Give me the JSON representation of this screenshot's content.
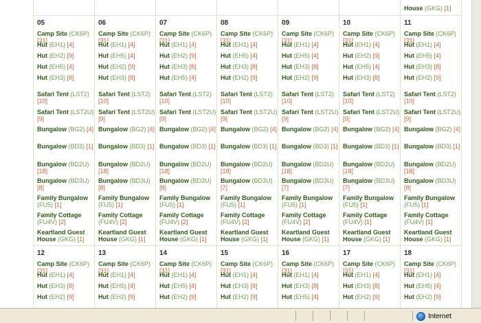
{
  "window": {
    "zone_label": "Internet",
    "zone_icon": "globe-icon"
  },
  "colors": {
    "name": "#2d5a16",
    "code": "#6a9a4a",
    "count": "#c86432",
    "grid": "#d8e6c8"
  },
  "calendar": {
    "top_partial": [
      {
        "cols": 6,
        "entries": []
      },
      {
        "cols": 1,
        "entries": [
          {
            "name": "House",
            "code": "(GKG)",
            "count": "[1]"
          }
        ]
      }
    ],
    "weeks": [
      {
        "days": [
          {
            "num": "05",
            "entries": [
              [
                "Camp Site",
                "(CK6P)",
                "[31]"
              ],
              [
                "Hut",
                "(EH1)",
                "[4]"
              ],
              [
                "Hut",
                "(EH2)",
                "[9]"
              ],
              [
                "Hut",
                "(EH5)",
                "[4]"
              ],
              [
                "Hut",
                "(EH3)",
                "[8]"
              ],
              [
                "Safari Tent",
                "(LST2)",
                "[10]"
              ],
              [
                "Safari Tent",
                "(LST2U)",
                "[9]"
              ],
              [
                "Bungalow",
                "(BG2)",
                "[4]"
              ],
              [
                "Bungalow",
                "(BD3)",
                "[1]"
              ],
              [
                "Bungalow",
                "(BD2U)",
                "[18]"
              ],
              [
                "Bungalow",
                "(BD3U)",
                "[8]"
              ],
              [
                "Family Bungalow",
                "(FU5)",
                "[1]"
              ],
              [
                "Family Cottage",
                "(FU4V)",
                "[2]"
              ],
              [
                "Keartland Guest House",
                "(GKG)",
                "[1]"
              ]
            ]
          },
          {
            "num": "06",
            "entries": [
              [
                "Camp Site",
                "(CK6P)",
                "[31]"
              ],
              [
                "Hut",
                "(EH1)",
                "[4]"
              ],
              [
                "Hut",
                "(EH5)",
                "[4]"
              ],
              [
                "Hut",
                "(EH2)",
                "[9]"
              ],
              [
                "Hut",
                "(EH3)",
                "[8]"
              ],
              [
                "Safari Tent",
                "(LST2)",
                "[10]"
              ],
              [
                "Safari Tent",
                "(LST2U)",
                "[9]"
              ],
              [
                "Bungalow",
                "(BG2)",
                "[4]"
              ],
              [
                "Bungalow",
                "(BD3)",
                "[1]"
              ],
              [
                "Bungalow",
                "(BD2U)",
                "[18]"
              ],
              [
                "Bungalow",
                "(BD3U)",
                "[8]"
              ],
              [
                "Family Bungalow",
                "(FU5)",
                "[1]"
              ],
              [
                "Family Cottage",
                "(FU4V)",
                "[2]"
              ],
              [
                "Keartland Guest House",
                "(GKG)",
                "[1]"
              ]
            ]
          },
          {
            "num": "07",
            "entries": [
              [
                "Camp Site",
                "(CK6P)",
                "[31]"
              ],
              [
                "Hut",
                "(EH1)",
                "[4]"
              ],
              [
                "Hut",
                "(EH2)",
                "[9]"
              ],
              [
                "Hut",
                "(EH3)",
                "[8]"
              ],
              [
                "Hut",
                "(EH5)",
                "[4]"
              ],
              [
                "Safari Tent",
                "(LST2)",
                "[10]"
              ],
              [
                "Safari Tent",
                "(LST2U)",
                "[9]"
              ],
              [
                "Bungalow",
                "(BG2)",
                "[4]"
              ],
              [
                "Bungalow",
                "(BD3)",
                "[1]"
              ],
              [
                "Bungalow",
                "(BD2U)",
                "[18]"
              ],
              [
                "Bungalow",
                "(BD3U)",
                "[8]"
              ],
              [
                "Family Bungalow",
                "(FU5)",
                "[1]"
              ],
              [
                "Family Cottage",
                "(FU4V)",
                "[2]"
              ],
              [
                "Keartland Guest House",
                "(GKG)",
                "[1]"
              ]
            ]
          },
          {
            "num": "08",
            "entries": [
              [
                "Camp Site",
                "(CK6P)",
                "[31]"
              ],
              [
                "Hut",
                "(EH1)",
                "[4]"
              ],
              [
                "Hut",
                "(EH5)",
                "[4]"
              ],
              [
                "Hut",
                "(EH3)",
                "[8]"
              ],
              [
                "Hut",
                "(EH2)",
                "[9]"
              ],
              [
                "Safari Tent",
                "(LST2)",
                "[10]"
              ],
              [
                "Safari Tent",
                "(LST2U)",
                "[9]"
              ],
              [
                "Bungalow",
                "(BG2)",
                "[4]"
              ],
              [
                "Bungalow",
                "(BD3)",
                "[1]"
              ],
              [
                "Bungalow",
                "(BD2U)",
                "[18]"
              ],
              [
                "Bungalow",
                "(BD3U)",
                "[7]"
              ],
              [
                "Family Bungalow",
                "(FU5)",
                "[1]"
              ],
              [
                "Family Cottage",
                "(FU4V)",
                "[2]"
              ],
              [
                "Keartland Guest House",
                "(GKG)",
                "[1]"
              ]
            ]
          },
          {
            "num": "09",
            "entries": [
              [
                "Camp Site",
                "(CK6P)",
                "[31]"
              ],
              [
                "Hut",
                "(EH1)",
                "[4]"
              ],
              [
                "Hut",
                "(EH5)",
                "[4]"
              ],
              [
                "Hut",
                "(EH3)",
                "[8]"
              ],
              [
                "Hut",
                "(EH2)",
                "[9]"
              ],
              [
                "Safari Tent",
                "(LST2)",
                "[10]"
              ],
              [
                "Safari Tent",
                "(LST2U)",
                "[9]"
              ],
              [
                "Bungalow",
                "(BG2)",
                "[4]"
              ],
              [
                "Bungalow",
                "(BD3)",
                "[1]"
              ],
              [
                "Bungalow",
                "(BD2U)",
                "[18]"
              ],
              [
                "Bungalow",
                "(BD3U)",
                "[7]"
              ],
              [
                "Family Bungalow",
                "(FU5)",
                "[1]"
              ],
              [
                "Family Cottage",
                "(FU4V)",
                "[2]"
              ],
              [
                "Keartland Guest House",
                "(GKG)",
                "[1]"
              ]
            ]
          },
          {
            "num": "10",
            "entries": [
              [
                "Camp Site",
                "(CK6P)",
                "[31]"
              ],
              [
                "Hut",
                "(EH1)",
                "[4]"
              ],
              [
                "Hut",
                "(EH2)",
                "[9]"
              ],
              [
                "Hut",
                "(EH5)",
                "[4]"
              ],
              [
                "Hut",
                "(EH3)",
                "[8]"
              ],
              [
                "Safari Tent",
                "(LST2)",
                "[10]"
              ],
              [
                "Safari Tent",
                "(LST2U)",
                "[9]"
              ],
              [
                "Bungalow",
                "(BG2)",
                "[4]"
              ],
              [
                "Bungalow",
                "(BD3)",
                "[1]"
              ],
              [
                "Bungalow",
                "(BD2U)",
                "[18]"
              ],
              [
                "Bungalow",
                "(BD3U)",
                "[7]"
              ],
              [
                "Family Bungalow",
                "(FU5)",
                "[1]"
              ],
              [
                "Family Cottage",
                "(FU4V)",
                "[1]"
              ],
              [
                "Keartland Guest House",
                "(GKG)",
                "[1]"
              ]
            ]
          },
          {
            "num": "11",
            "entries": [
              [
                "Camp Site",
                "(CK6P)",
                "[31]"
              ],
              [
                "Hut",
                "(EH1)",
                "[4]"
              ],
              [
                "Hut",
                "(EH5)",
                "[4]"
              ],
              [
                "Hut",
                "(EH3)",
                "[8]"
              ],
              [
                "Hut",
                "(EH2)",
                "[9]"
              ],
              [
                "Safari Tent",
                "(LST2)",
                "[10]"
              ],
              [
                "Safari Tent",
                "(LST2U)",
                "[9]"
              ],
              [
                "Bungalow",
                "(BG2)",
                "[4]"
              ],
              [
                "Bungalow",
                "(BD3)",
                "[1]"
              ],
              [
                "Bungalow",
                "(BD2U)",
                "[18]"
              ],
              [
                "Bungalow",
                "(BD3U)",
                "[8]"
              ],
              [
                "Family Bungalow",
                "(FU5)",
                "[1]"
              ],
              [
                "Family Cottage",
                "(FU4V)",
                "[1]"
              ],
              [
                "Keartland Guest House",
                "(GKG)",
                "[1]"
              ]
            ]
          }
        ]
      },
      {
        "days": [
          {
            "num": "12",
            "entries": [
              [
                "Camp Site",
                "(CK6P)",
                "[31]"
              ],
              [
                "Hut",
                "(EH1)",
                "[4]"
              ],
              [
                "Hut",
                "(EH3)",
                "[8]"
              ],
              [
                "Hut",
                "(EH2)",
                "[9]"
              ]
            ]
          },
          {
            "num": "13",
            "entries": [
              [
                "Camp Site",
                "(CK6P)",
                "[31]"
              ],
              [
                "Hut",
                "(EH1)",
                "[4]"
              ],
              [
                "Hut",
                "(EH5)",
                "[4]"
              ],
              [
                "Hut",
                "(EH2)",
                "[9]"
              ]
            ]
          },
          {
            "num": "14",
            "entries": [
              [
                "Camp Site",
                "(CK6P)",
                "[31]"
              ],
              [
                "Hut",
                "(EH1)",
                "[4]"
              ],
              [
                "Hut",
                "(EH5)",
                "[4]"
              ],
              [
                "Hut",
                "(EH2)",
                "[9]"
              ]
            ]
          },
          {
            "num": "15",
            "entries": [
              [
                "Camp Site",
                "(CK6P)",
                "[31]"
              ],
              [
                "Hut",
                "(EH1)",
                "[4]"
              ],
              [
                "Hut",
                "(EH3)",
                "[8]"
              ],
              [
                "Hut",
                "(EH2)",
                "[9]"
              ]
            ]
          },
          {
            "num": "16",
            "entries": [
              [
                "Camp Site",
                "(CK6P)",
                "[31]"
              ],
              [
                "Hut",
                "(EH1)",
                "[4]"
              ],
              [
                "Hut",
                "(EH3)",
                "[8]"
              ],
              [
                "Hut",
                "(EH5)",
                "[4]"
              ]
            ]
          },
          {
            "num": "17",
            "entries": [
              [
                "Camp Site",
                "(CK6P)",
                "[31]"
              ],
              [
                "Hut",
                "(EH1)",
                "[4]"
              ],
              [
                "Hut",
                "(EH3)",
                "[8]"
              ],
              [
                "Hut",
                "(EH2)",
                "[9]"
              ]
            ]
          },
          {
            "num": "18",
            "entries": [
              [
                "Camp Site",
                "(CK6P)",
                "[31]"
              ],
              [
                "Hut",
                "(EH1)",
                "[4]"
              ],
              [
                "Hut",
                "(EH5)",
                "[4]"
              ],
              [
                "Hut",
                "(EH2)",
                "[9]"
              ]
            ]
          }
        ]
      }
    ]
  }
}
